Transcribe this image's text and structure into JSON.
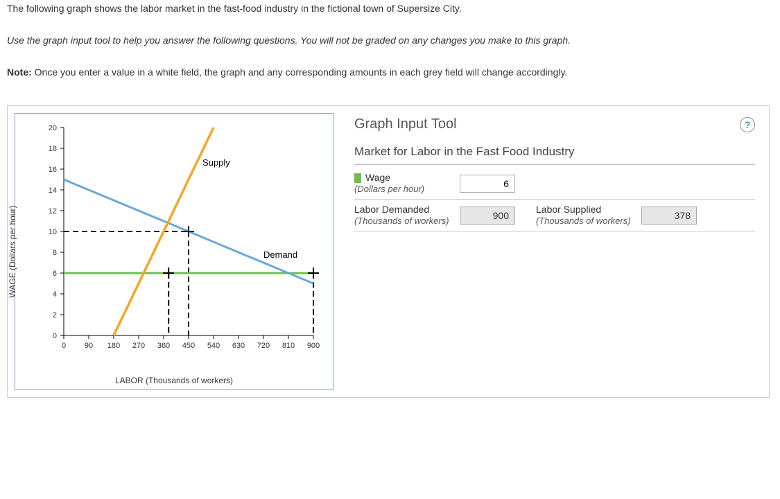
{
  "intro": "The following graph shows the labor market in the fast-food industry in the fictional town of Supersize City.",
  "instruction": "Use the graph input tool to help you answer the following questions. You will not be graded on any changes you make to this graph.",
  "note_prefix": "Note:",
  "note_body": " Once you enter a value in a white field, the graph and any corresponding amounts in each grey field will change accordingly.",
  "tool": {
    "title": "Graph Input Tool",
    "help": "?",
    "subtitle": "Market for Labor in the Fast Food Industry",
    "wage_label": "Wage",
    "wage_sub": "(Dollars per hour)",
    "wage_value": "6",
    "ld_label": "Labor Demanded",
    "ld_sub": "(Thousands of workers)",
    "ld_value": "900",
    "ls_label": "Labor Supplied",
    "ls_sub": "(Thousands of workers)",
    "ls_value": "378"
  },
  "chart": {
    "ylabel": "WAGE (Dollars per hour)",
    "xlabel": "LABOR (Thousands of workers)",
    "supply_label": "Supply",
    "demand_label": "Demand",
    "x_ticks": [
      "0",
      "90",
      "180",
      "270",
      "360",
      "450",
      "540",
      "630",
      "720",
      "810",
      "900"
    ],
    "y_ticks": [
      "0",
      "2",
      "4",
      "6",
      "8",
      "10",
      "12",
      "14",
      "16",
      "18",
      "20"
    ]
  },
  "chart_data": {
    "type": "line",
    "title": "Market for Labor in the Fast Food Industry",
    "xlabel": "LABOR (Thousands of workers)",
    "ylabel": "WAGE (Dollars per hour)",
    "xlim": [
      0,
      900
    ],
    "ylim": [
      0,
      20
    ],
    "series": [
      {
        "name": "Supply",
        "color": "#f5a623",
        "x": [
          180,
          378,
          450,
          540
        ],
        "y": [
          0,
          6,
          10,
          20
        ]
      },
      {
        "name": "Demand",
        "color": "#5aa8d6",
        "x": [
          0,
          450,
          900
        ],
        "y": [
          15,
          10,
          5
        ]
      },
      {
        "name": "Wage line",
        "color": "#6fbf4a",
        "x": [
          0,
          900
        ],
        "y": [
          6,
          6
        ]
      }
    ],
    "markers": [
      {
        "x": 378,
        "y": 6,
        "note": "Labor Supplied at wage 6"
      },
      {
        "x": 450,
        "y": 10,
        "note": "Equilibrium"
      },
      {
        "x": 900,
        "y": 6,
        "note": "Labor Demanded at wage 6"
      }
    ],
    "guide_lines": [
      {
        "axis": "x",
        "value": 450,
        "from_y": 0,
        "to_y": 10,
        "style": "dashed"
      },
      {
        "axis": "y",
        "value": 10,
        "from_x": 0,
        "to_x": 450,
        "style": "dashed"
      },
      {
        "axis": "x",
        "value": 378,
        "from_y": 0,
        "to_y": 6,
        "style": "dashed"
      },
      {
        "axis": "x",
        "value": 900,
        "from_y": 0,
        "to_y": 6,
        "style": "dashed"
      }
    ]
  }
}
